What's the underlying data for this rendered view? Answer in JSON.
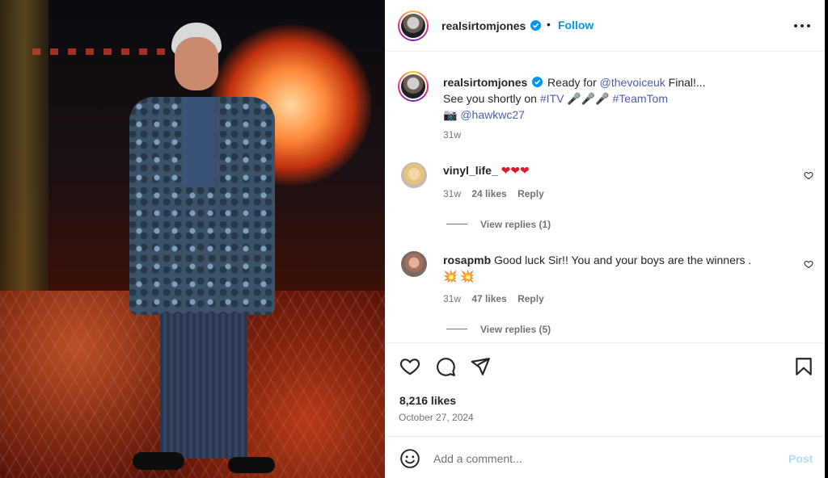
{
  "post": {
    "username": "realsirtomjones",
    "separator": "•",
    "follow_label": "Follow",
    "caption": {
      "lead": "Ready for ",
      "mention1": "@thevoiceuk",
      "after_mention1": " Final!...",
      "line2_lead": "See you shortly on ",
      "hashtag_itv": "#ITV",
      "mics": "🎤🎤🎤",
      "hashtag_team": "#TeamTom",
      "camera": "📷",
      "mention2": "@hawkwc27",
      "time": "31w"
    },
    "likes": "8,216 likes",
    "date": "October 27, 2024"
  },
  "comments": [
    {
      "username": "vinyl_life_",
      "text": "",
      "emoji": "❤❤❤",
      "time": "31w",
      "likes": "24 likes",
      "reply_label": "Reply",
      "view_replies": "View replies (1)"
    },
    {
      "username": "rosapmb",
      "text": "Good luck Sir!! You and your boys are the winners .",
      "emoji": "💥 💥",
      "time": "31w",
      "likes": "47 likes",
      "reply_label": "Reply",
      "view_replies": "View replies (5)"
    }
  ],
  "add_comment": {
    "placeholder": "Add a comment...",
    "post_label": "Post"
  },
  "icons": {
    "more": "more-icon",
    "verified": "verified-badge-icon",
    "like": "heart-icon",
    "comment": "comment-icon",
    "share": "share-icon",
    "save": "bookmark-icon",
    "emoji": "emoji-icon"
  },
  "colors": {
    "accent": "#0095f6",
    "link": "#4a5db5",
    "muted": "#737373",
    "post_disabled": "#b3dbff"
  }
}
